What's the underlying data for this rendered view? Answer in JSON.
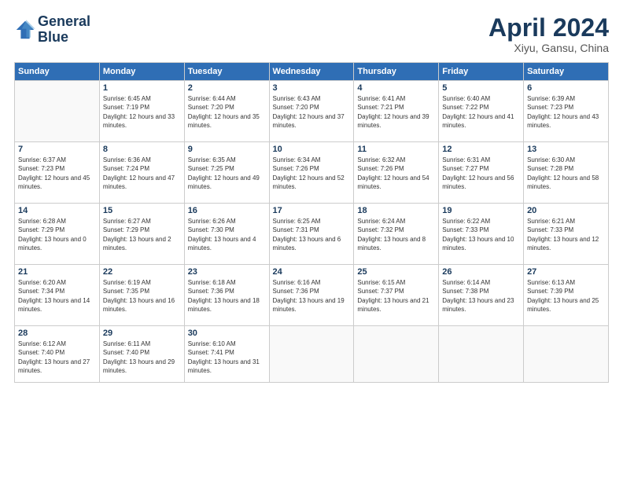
{
  "logo": {
    "line1": "General",
    "line2": "Blue"
  },
  "title": "April 2024",
  "subtitle": "Xiyu, Gansu, China",
  "headers": [
    "Sunday",
    "Monday",
    "Tuesday",
    "Wednesday",
    "Thursday",
    "Friday",
    "Saturday"
  ],
  "weeks": [
    [
      {
        "day": "",
        "sunrise": "",
        "sunset": "",
        "daylight": ""
      },
      {
        "day": "1",
        "sunrise": "Sunrise: 6:45 AM",
        "sunset": "Sunset: 7:19 PM",
        "daylight": "Daylight: 12 hours and 33 minutes."
      },
      {
        "day": "2",
        "sunrise": "Sunrise: 6:44 AM",
        "sunset": "Sunset: 7:20 PM",
        "daylight": "Daylight: 12 hours and 35 minutes."
      },
      {
        "day": "3",
        "sunrise": "Sunrise: 6:43 AM",
        "sunset": "Sunset: 7:20 PM",
        "daylight": "Daylight: 12 hours and 37 minutes."
      },
      {
        "day": "4",
        "sunrise": "Sunrise: 6:41 AM",
        "sunset": "Sunset: 7:21 PM",
        "daylight": "Daylight: 12 hours and 39 minutes."
      },
      {
        "day": "5",
        "sunrise": "Sunrise: 6:40 AM",
        "sunset": "Sunset: 7:22 PM",
        "daylight": "Daylight: 12 hours and 41 minutes."
      },
      {
        "day": "6",
        "sunrise": "Sunrise: 6:39 AM",
        "sunset": "Sunset: 7:23 PM",
        "daylight": "Daylight: 12 hours and 43 minutes."
      }
    ],
    [
      {
        "day": "7",
        "sunrise": "Sunrise: 6:37 AM",
        "sunset": "Sunset: 7:23 PM",
        "daylight": "Daylight: 12 hours and 45 minutes."
      },
      {
        "day": "8",
        "sunrise": "Sunrise: 6:36 AM",
        "sunset": "Sunset: 7:24 PM",
        "daylight": "Daylight: 12 hours and 47 minutes."
      },
      {
        "day": "9",
        "sunrise": "Sunrise: 6:35 AM",
        "sunset": "Sunset: 7:25 PM",
        "daylight": "Daylight: 12 hours and 49 minutes."
      },
      {
        "day": "10",
        "sunrise": "Sunrise: 6:34 AM",
        "sunset": "Sunset: 7:26 PM",
        "daylight": "Daylight: 12 hours and 52 minutes."
      },
      {
        "day": "11",
        "sunrise": "Sunrise: 6:32 AM",
        "sunset": "Sunset: 7:26 PM",
        "daylight": "Daylight: 12 hours and 54 minutes."
      },
      {
        "day": "12",
        "sunrise": "Sunrise: 6:31 AM",
        "sunset": "Sunset: 7:27 PM",
        "daylight": "Daylight: 12 hours and 56 minutes."
      },
      {
        "day": "13",
        "sunrise": "Sunrise: 6:30 AM",
        "sunset": "Sunset: 7:28 PM",
        "daylight": "Daylight: 12 hours and 58 minutes."
      }
    ],
    [
      {
        "day": "14",
        "sunrise": "Sunrise: 6:28 AM",
        "sunset": "Sunset: 7:29 PM",
        "daylight": "Daylight: 13 hours and 0 minutes."
      },
      {
        "day": "15",
        "sunrise": "Sunrise: 6:27 AM",
        "sunset": "Sunset: 7:29 PM",
        "daylight": "Daylight: 13 hours and 2 minutes."
      },
      {
        "day": "16",
        "sunrise": "Sunrise: 6:26 AM",
        "sunset": "Sunset: 7:30 PM",
        "daylight": "Daylight: 13 hours and 4 minutes."
      },
      {
        "day": "17",
        "sunrise": "Sunrise: 6:25 AM",
        "sunset": "Sunset: 7:31 PM",
        "daylight": "Daylight: 13 hours and 6 minutes."
      },
      {
        "day": "18",
        "sunrise": "Sunrise: 6:24 AM",
        "sunset": "Sunset: 7:32 PM",
        "daylight": "Daylight: 13 hours and 8 minutes."
      },
      {
        "day": "19",
        "sunrise": "Sunrise: 6:22 AM",
        "sunset": "Sunset: 7:33 PM",
        "daylight": "Daylight: 13 hours and 10 minutes."
      },
      {
        "day": "20",
        "sunrise": "Sunrise: 6:21 AM",
        "sunset": "Sunset: 7:33 PM",
        "daylight": "Daylight: 13 hours and 12 minutes."
      }
    ],
    [
      {
        "day": "21",
        "sunrise": "Sunrise: 6:20 AM",
        "sunset": "Sunset: 7:34 PM",
        "daylight": "Daylight: 13 hours and 14 minutes."
      },
      {
        "day": "22",
        "sunrise": "Sunrise: 6:19 AM",
        "sunset": "Sunset: 7:35 PM",
        "daylight": "Daylight: 13 hours and 16 minutes."
      },
      {
        "day": "23",
        "sunrise": "Sunrise: 6:18 AM",
        "sunset": "Sunset: 7:36 PM",
        "daylight": "Daylight: 13 hours and 18 minutes."
      },
      {
        "day": "24",
        "sunrise": "Sunrise: 6:16 AM",
        "sunset": "Sunset: 7:36 PM",
        "daylight": "Daylight: 13 hours and 19 minutes."
      },
      {
        "day": "25",
        "sunrise": "Sunrise: 6:15 AM",
        "sunset": "Sunset: 7:37 PM",
        "daylight": "Daylight: 13 hours and 21 minutes."
      },
      {
        "day": "26",
        "sunrise": "Sunrise: 6:14 AM",
        "sunset": "Sunset: 7:38 PM",
        "daylight": "Daylight: 13 hours and 23 minutes."
      },
      {
        "day": "27",
        "sunrise": "Sunrise: 6:13 AM",
        "sunset": "Sunset: 7:39 PM",
        "daylight": "Daylight: 13 hours and 25 minutes."
      }
    ],
    [
      {
        "day": "28",
        "sunrise": "Sunrise: 6:12 AM",
        "sunset": "Sunset: 7:40 PM",
        "daylight": "Daylight: 13 hours and 27 minutes."
      },
      {
        "day": "29",
        "sunrise": "Sunrise: 6:11 AM",
        "sunset": "Sunset: 7:40 PM",
        "daylight": "Daylight: 13 hours and 29 minutes."
      },
      {
        "day": "30",
        "sunrise": "Sunrise: 6:10 AM",
        "sunset": "Sunset: 7:41 PM",
        "daylight": "Daylight: 13 hours and 31 minutes."
      },
      {
        "day": "",
        "sunrise": "",
        "sunset": "",
        "daylight": ""
      },
      {
        "day": "",
        "sunrise": "",
        "sunset": "",
        "daylight": ""
      },
      {
        "day": "",
        "sunrise": "",
        "sunset": "",
        "daylight": ""
      },
      {
        "day": "",
        "sunrise": "",
        "sunset": "",
        "daylight": ""
      }
    ]
  ]
}
